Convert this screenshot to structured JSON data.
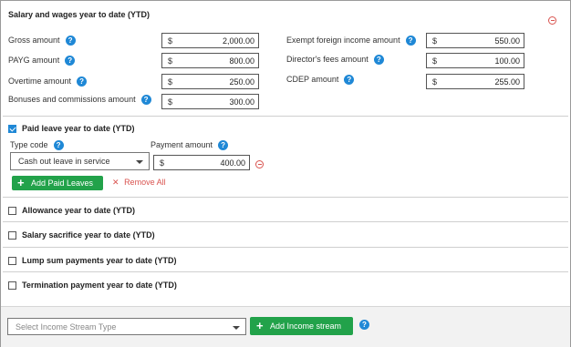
{
  "ytd": {
    "title": "Salary and wages year to date (YTD)",
    "currency": "$",
    "left_fields": [
      {
        "label": "Gross amount",
        "value": "2,000.00"
      },
      {
        "label": "PAYG amount",
        "value": "800.00"
      },
      {
        "label": "Overtime amount",
        "value": "250.00"
      },
      {
        "label": "Bonuses and commissions amount",
        "value": "300.00"
      }
    ],
    "right_fields": [
      {
        "label": "Exempt foreign income amount",
        "value": "550.00"
      },
      {
        "label": "Director's fees amount",
        "value": "100.00"
      },
      {
        "label": "CDEP amount",
        "value": "255.00"
      }
    ]
  },
  "paid_leave": {
    "title": "Paid leave year to date (YTD)",
    "checked": true,
    "type_code_label": "Type code",
    "payment_amount_label": "Payment amount",
    "type_code_value": "Cash out leave in service",
    "currency": "$",
    "payment_amount_value": "400.00",
    "add_button": "Add Paid Leaves",
    "remove_all": "Remove All"
  },
  "sections": [
    {
      "title": "Allowance year to date (YTD)",
      "checked": false
    },
    {
      "title": "Salary sacrifice year to date (YTD)",
      "checked": false
    },
    {
      "title": "Lump sum payments year to date (YTD)",
      "checked": false
    },
    {
      "title": "Termination payment year to date (YTD)",
      "checked": false
    }
  ],
  "footer": {
    "select_placeholder": "Select Income Stream Type",
    "add_button": "Add Income stream"
  },
  "colors": {
    "accent": "#1f88d6",
    "green": "#22a24a",
    "remove": "#d9534f"
  },
  "icons": {
    "help": "question-circle-icon",
    "remove": "minus-circle-icon",
    "plus": "plus-icon",
    "x": "close-icon"
  }
}
